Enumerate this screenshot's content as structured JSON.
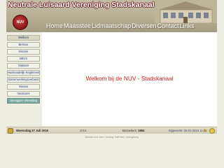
{
  "header": {
    "title": "Neutrale Luisaard Vereniging Stadskanaal",
    "logo_text": "NUV"
  },
  "topnav": [
    "Home",
    "Maasstee",
    "Lidmaatschap",
    "Diversen",
    "Contact",
    "Links"
  ],
  "sidebar": [
    "Welkom",
    "Bestuur",
    "Historie",
    "NBVS",
    "Statuten",
    "Huishoudelijk Reglement",
    "Samenwerkingsverband",
    "Nieuws",
    "Vacatures",
    "Opvoggen Vilvoeding"
  ],
  "main": {
    "welcome": "Welkom bij de NUV - Stadskanaal"
  },
  "statusbar": {
    "date": "Woensdag 27 Juli 2016",
    "year": "2016",
    "visitors_label": "Bezoekers:",
    "visitors_count": "1864",
    "updated": "Bijgewerkt: 05-01-2016 11:44"
  },
  "footer": "Website met Joint | Hosting: NetPoint | Vormgeving"
}
